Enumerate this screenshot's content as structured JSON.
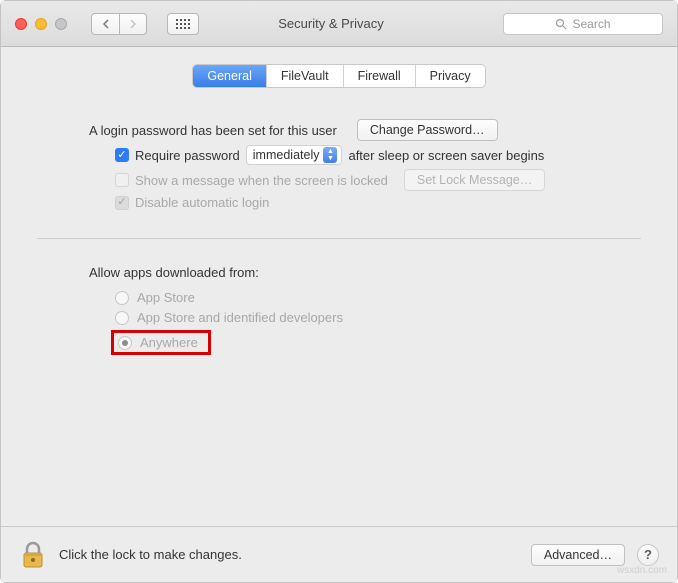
{
  "window": {
    "title": "Security & Privacy",
    "search_placeholder": "Search"
  },
  "tabs": [
    {
      "label": "General",
      "active": true
    },
    {
      "label": "FileVault",
      "active": false
    },
    {
      "label": "Firewall",
      "active": false
    },
    {
      "label": "Privacy",
      "active": false
    }
  ],
  "password_section": {
    "login_password_set": "A login password has been set for this user",
    "change_password_btn": "Change Password…",
    "require_password_label": "Require password",
    "require_password_delay": "immediately",
    "require_password_suffix": "after sleep or screen saver begins",
    "show_message_label": "Show a message when the screen is locked",
    "set_lock_message_btn": "Set Lock Message…",
    "disable_auto_login_label": "Disable automatic login"
  },
  "allow_apps": {
    "heading": "Allow apps downloaded from:",
    "options": [
      {
        "label": "App Store",
        "selected": false
      },
      {
        "label": "App Store and identified developers",
        "selected": false
      },
      {
        "label": "Anywhere",
        "selected": true,
        "highlighted": true
      }
    ]
  },
  "footer": {
    "lock_text": "Click the lock to make changes.",
    "advanced_btn": "Advanced…"
  },
  "watermark": "wsxdn.com"
}
